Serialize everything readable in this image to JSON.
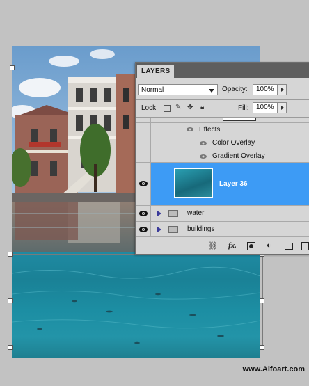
{
  "panel": {
    "tab_label": "LAYERS",
    "blend_mode": "Normal",
    "opacity_label": "Opacity:",
    "opacity_value": "100%",
    "lock_label": "Lock:",
    "fill_label": "Fill:",
    "fill_value": "100%",
    "effects_label": "Effects",
    "effects": [
      "Color Overlay",
      "Gradient Overlay"
    ],
    "layers": [
      {
        "name": "Layer 36",
        "selected": true,
        "visible": true
      },
      {
        "name": "water",
        "type": "group",
        "visible": true
      },
      {
        "name": "buildings",
        "type": "group",
        "visible": true
      }
    ],
    "bottom_icons": [
      "link-icon",
      "fx-icon",
      "mask-icon",
      "adjustment-icon",
      "folder-icon",
      "new-layer-icon"
    ]
  },
  "watermark": "www.Alfoart.com",
  "colors": {
    "selection": "#3d9bf5",
    "panel_bg": "#d6d6d6",
    "water": "#1f8aa2",
    "sky": "#8bb6db"
  }
}
